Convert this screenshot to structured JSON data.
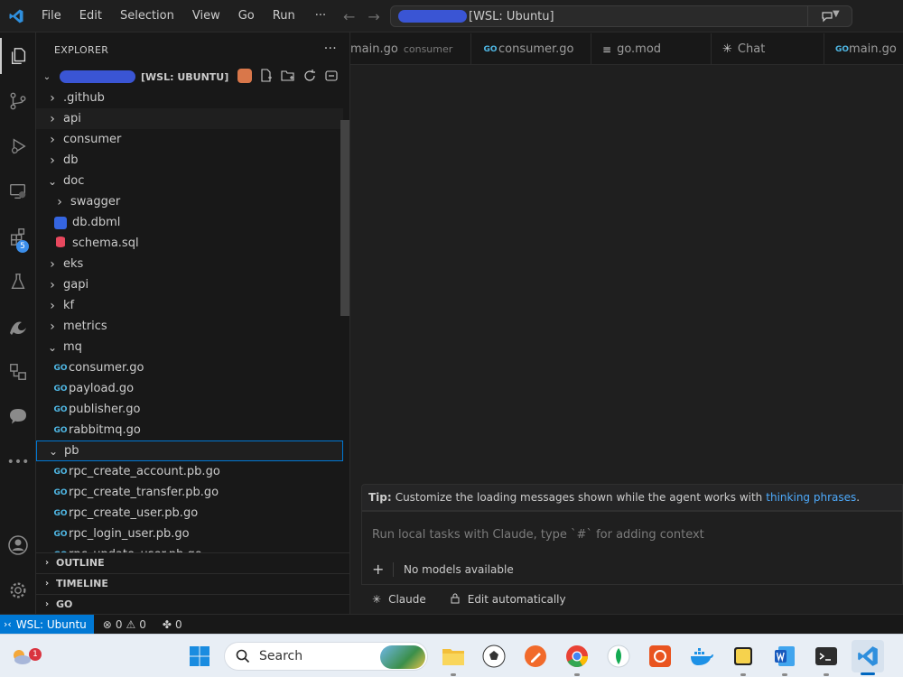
{
  "titlebar": {
    "menu": [
      "File",
      "Edit",
      "Selection",
      "View",
      "Go",
      "Run"
    ],
    "more": "···",
    "command_center": "[WSL: Ubuntu]"
  },
  "activity": {
    "extensions_badge": "5"
  },
  "sidebar": {
    "title": "EXPLORER",
    "more": "···",
    "root_label": "[WSL: UBUNTU]",
    "tree": [
      {
        "label": ".github",
        "type": "folder",
        "depth": 0,
        "open": false
      },
      {
        "label": "api",
        "type": "folder",
        "depth": 0,
        "open": false
      },
      {
        "label": "consumer",
        "type": "folder",
        "depth": 0,
        "open": false
      },
      {
        "label": "db",
        "type": "folder",
        "depth": 0,
        "open": false
      },
      {
        "label": "doc",
        "type": "folder",
        "depth": 0,
        "open": true
      },
      {
        "label": "swagger",
        "type": "folder",
        "depth": 1,
        "open": false
      },
      {
        "label": "db.dbml",
        "type": "dbml",
        "depth": 1
      },
      {
        "label": "schema.sql",
        "type": "sql",
        "depth": 1
      },
      {
        "label": "eks",
        "type": "folder",
        "depth": 0,
        "open": false
      },
      {
        "label": "gapi",
        "type": "folder",
        "depth": 0,
        "open": false
      },
      {
        "label": "kf",
        "type": "folder",
        "depth": 0,
        "open": false
      },
      {
        "label": "metrics",
        "type": "folder",
        "depth": 0,
        "open": false
      },
      {
        "label": "mq",
        "type": "folder",
        "depth": 0,
        "open": true
      },
      {
        "label": "consumer.go",
        "type": "go",
        "depth": 1
      },
      {
        "label": "payload.go",
        "type": "go",
        "depth": 1
      },
      {
        "label": "publisher.go",
        "type": "go",
        "depth": 1
      },
      {
        "label": "rabbitmq.go",
        "type": "go",
        "depth": 1
      },
      {
        "label": "pb",
        "type": "folder",
        "depth": 0,
        "open": true,
        "selected": true
      },
      {
        "label": "rpc_create_account.pb.go",
        "type": "go",
        "depth": 1
      },
      {
        "label": "rpc_create_transfer.pb.go",
        "type": "go",
        "depth": 1
      },
      {
        "label": "rpc_create_user.pb.go",
        "type": "go",
        "depth": 1
      },
      {
        "label": "rpc_login_user.pb.go",
        "type": "go",
        "depth": 1
      },
      {
        "label": "rpc_update_user.pb.go",
        "type": "go",
        "depth": 1
      }
    ],
    "sections": [
      "OUTLINE",
      "TIMELINE",
      "GO"
    ]
  },
  "tabs": [
    {
      "label": "main.go",
      "desc": "consumer",
      "icon": "none"
    },
    {
      "label": "consumer.go",
      "desc": "",
      "icon": "go"
    },
    {
      "label": "go.mod",
      "desc": "",
      "icon": "lines"
    },
    {
      "label": "Chat",
      "desc": "",
      "icon": "sparkle"
    },
    {
      "label": "main.go",
      "desc": "",
      "icon": "go"
    }
  ],
  "chat": {
    "tip_prefix": "Tip:",
    "tip_text": "Customize the loading messages shown while the agent works with",
    "tip_link": "thinking phrases",
    "tip_suffix": ".",
    "input_placeholder": "Run local tasks with Claude, type `#` for adding context",
    "models": "No models available",
    "agent": "Claude",
    "mode": "Edit automatically"
  },
  "statusbar": {
    "remote": "WSL: Ubuntu",
    "errors": "0",
    "warnings": "0",
    "ports": "0"
  },
  "taskbar": {
    "search_label": "Search",
    "weather_badge": "1"
  },
  "colors": {
    "accent": "#0078d4",
    "go_blue": "#4fb7e4",
    "link": "#4daafc"
  }
}
